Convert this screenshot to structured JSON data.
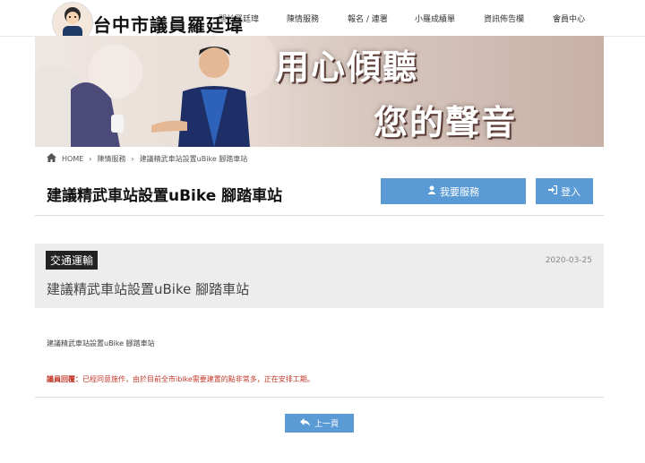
{
  "site": {
    "title": "台中市議員羅廷瑋"
  },
  "nav": {
    "items": [
      "關於羅廷瑋",
      "陳情服務",
      "報名 / 連署",
      "小羅成績單",
      "資訊佈告欄",
      "會員中心"
    ]
  },
  "banner": {
    "line1": "用心傾聽",
    "line2": "您的聲音"
  },
  "breadcrumb": {
    "home": "HOME",
    "section": "陳情服務",
    "current": "建議精武車站設置uBike 腳踏車站"
  },
  "page": {
    "title": "建議精武車站設置uBike 腳踏車站"
  },
  "buttons": {
    "service": "我要服務",
    "login": "登入",
    "back": "上一頁"
  },
  "article": {
    "category": "交通運輸",
    "date": "2020-03-25",
    "title": "建議精武車站設置uBike 腳踏車站",
    "body": "建議精武車站設置uBike 腳踏車站",
    "reply_label": "議員回覆：",
    "reply_text": "已經同意施作，由於目前全市ibike需要建置的點非常多，正在安排工期。"
  },
  "colors": {
    "button": "#5b9bd5",
    "reply": "#c0392b",
    "tag_bg": "#222222",
    "card_bg": "#ededed"
  }
}
